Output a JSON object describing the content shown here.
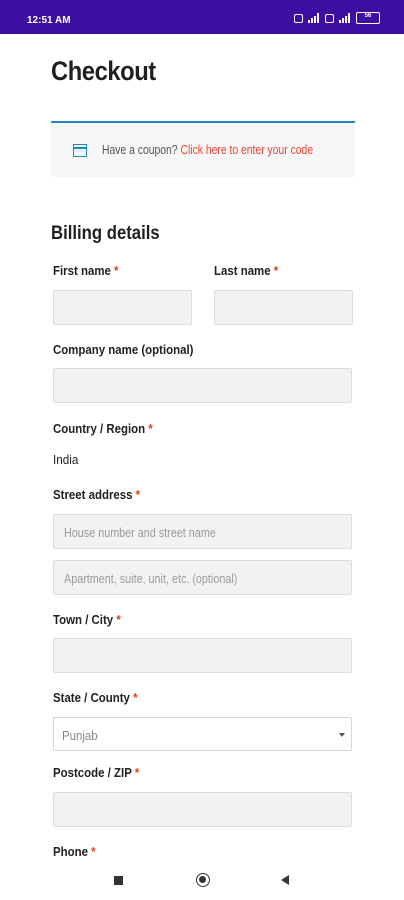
{
  "status_bar": {
    "time": "12:51 AM",
    "battery": "56"
  },
  "page": {
    "title": "Checkout"
  },
  "coupon": {
    "text": "Have a coupon?",
    "link": "Click here to enter your code"
  },
  "billing": {
    "title": "Billing details",
    "required_mark": "*",
    "first_name": {
      "label": "First name"
    },
    "last_name": {
      "label": "Last name"
    },
    "company": {
      "label": "Company name (optional)"
    },
    "country": {
      "label": "Country / Region",
      "value": "India"
    },
    "street": {
      "label": "Street address",
      "placeholder1": "House number and street name",
      "placeholder2": "Apartment, suite, unit, etc. (optional)"
    },
    "city": {
      "label": "Town / City"
    },
    "state": {
      "label": "State / County",
      "value": "Punjab"
    },
    "postcode": {
      "label": "Postcode / ZIP"
    },
    "phone": {
      "label": "Phone"
    }
  },
  "colors": {
    "status_bar": "#3d0fa0",
    "accent": "#1e85be",
    "link": "#e8442d",
    "required": "#e2401c"
  }
}
